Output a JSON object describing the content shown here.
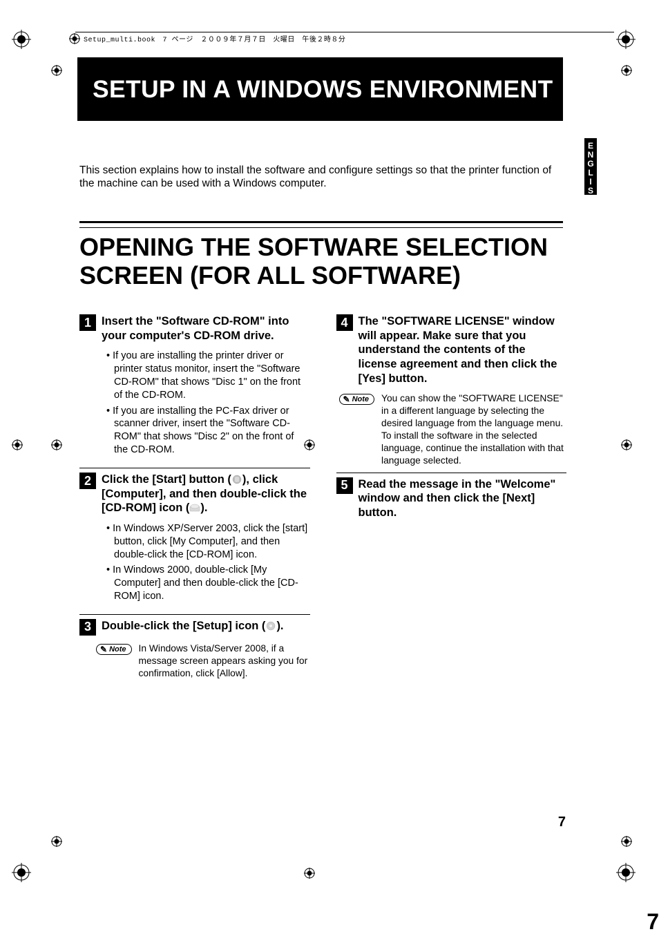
{
  "header_line": "Setup_multi.book　7 ページ　２００９年７月７日　火曜日　午後２時８分",
  "language_tab": "ENGLISH",
  "title_banner": "SETUP IN A WINDOWS ENVIRONMENT",
  "intro": "This section explains how to install the software and configure settings so that the printer function of the machine can be used with a Windows computer.",
  "section_title": "OPENING THE SOFTWARE SELECTION SCREEN (FOR ALL SOFTWARE)",
  "steps": {
    "s1": {
      "num": "1",
      "title": "Insert the \"Software CD-ROM\" into your computer's CD-ROM drive.",
      "bullets": [
        "If you are installing the printer driver or printer status monitor, insert the \"Software CD-ROM\" that shows \"Disc 1\" on the front of the CD-ROM.",
        "If you are installing the PC-Fax driver or scanner driver, insert the \"Software CD-ROM\" that shows \"Disc 2\" on the front of the CD-ROM."
      ]
    },
    "s2": {
      "num": "2",
      "title_a": "Click the [Start] button (",
      "title_b": "), click [Computer], and then double-click the [CD-ROM] icon (",
      "title_c": ").",
      "bullets": [
        "In Windows XP/Server 2003, click the [start] button, click [My Computer], and then double-click the [CD-ROM] icon.",
        "In Windows 2000, double-click [My Computer] and then double-click the [CD-ROM] icon."
      ]
    },
    "s3": {
      "num": "3",
      "title_a": "Double-click the [Setup] icon (",
      "title_b": ").",
      "note": "In Windows Vista/Server 2008, if a message screen appears asking you for confirmation, click [Allow]."
    },
    "s4": {
      "num": "4",
      "title": "The \"SOFTWARE LICENSE\" window will appear. Make sure that you understand the contents of the license agreement and then click the [Yes] button.",
      "note": "You can show the \"SOFTWARE LICENSE\" in a different language by selecting the desired language from the language menu. To install the software in the selected language, continue the installation with that language selected."
    },
    "s5": {
      "num": "5",
      "title": "Read the message in the \"Welcome\" window and then click the [Next] button."
    }
  },
  "note_label": "Note",
  "page_number": "7",
  "side_slice": "7"
}
